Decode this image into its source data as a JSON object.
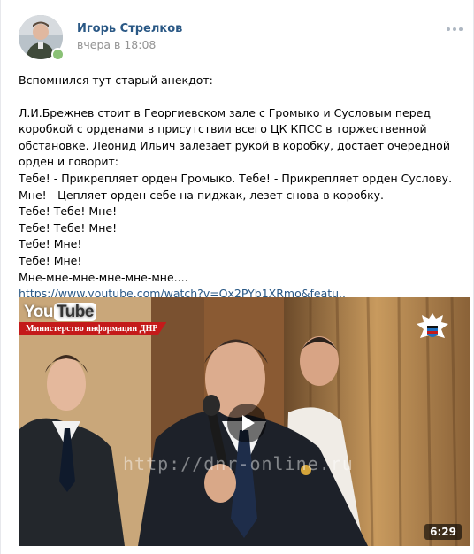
{
  "post": {
    "author": "Игорь Стрелков",
    "time": "вчера в 18:08",
    "paragraphs": [
      "Вспомнился тут старый анекдот:",
      "Л.И.Брежнев стоит в Георгиевском зале с Громыко и Сусловым перед коробкой с орденами в присутствии всего ЦК КПСС в торжественной обстановке. Леонид Ильич залезает рукой в коробку, достает очередной орден и говорит:",
      "Тебе! - Прикрепляет орден Громыко. Тебе! - Прикрепляет орден Суслову. Мне! - Цепляет орден себе на пиджак, лезет снова в коробку.",
      "Тебе! Тебе! Мне!",
      "Тебе! Тебе! Мне!",
      "Тебе! Мне!",
      "Тебе! Мне!",
      "Мне-мне-мне-мне-мне-мне...."
    ],
    "link": "https://www.youtube.com/watch?v=Qx2PYb1XRmo&featu.."
  },
  "video": {
    "youtube_logo_you": "You",
    "youtube_logo_tube": "Tube",
    "ministry_banner": "Министерство информации ДНР",
    "watermark": "http://dnr-online.ru",
    "duration": "6:29"
  },
  "colors": {
    "link": "#2a5885",
    "meta": "#939393",
    "online": "#8ac176",
    "banner_red": "#c41a1a"
  },
  "icons": {
    "more": "three-dots-icon",
    "play": "play-icon",
    "online": "online-dot-icon",
    "emblem": "dnr-emblem-icon"
  }
}
